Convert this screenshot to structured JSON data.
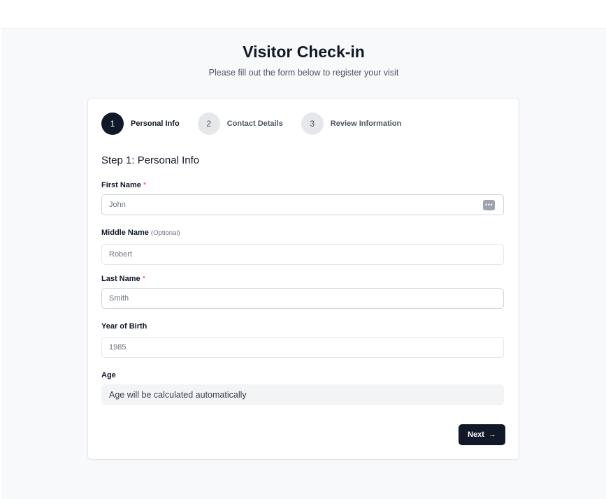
{
  "header": {
    "title": "Visitor Check-in",
    "subtitle": "Please fill out the form below to register your visit"
  },
  "steps": [
    {
      "number": "1",
      "label": "Personal Info",
      "state": "active"
    },
    {
      "number": "2",
      "label": "Contact Details",
      "state": "inactive"
    },
    {
      "number": "3",
      "label": "Review Information",
      "state": "inactive"
    }
  ],
  "form": {
    "heading": "Step 1: Personal Info",
    "first_name": {
      "label": "First Name",
      "required_mark": "*",
      "value": "John",
      "icon": "autofill-dots-icon"
    },
    "middle_name": {
      "label": "Middle Name",
      "optional_note": "(Optional)",
      "value": "Robert"
    },
    "last_name": {
      "label": "Last Name",
      "required_mark": "*",
      "value": "Smith"
    },
    "year_of_birth": {
      "label": "Year of Birth",
      "value": "1985"
    },
    "age": {
      "label": "Age",
      "value": "Age will be calculated automatically"
    }
  },
  "actions": {
    "next_label": "Next",
    "next_arrow": "→"
  },
  "colors": {
    "primary": "#111827",
    "required": "#ef4444",
    "step_inactive": "#e5e7eb"
  }
}
